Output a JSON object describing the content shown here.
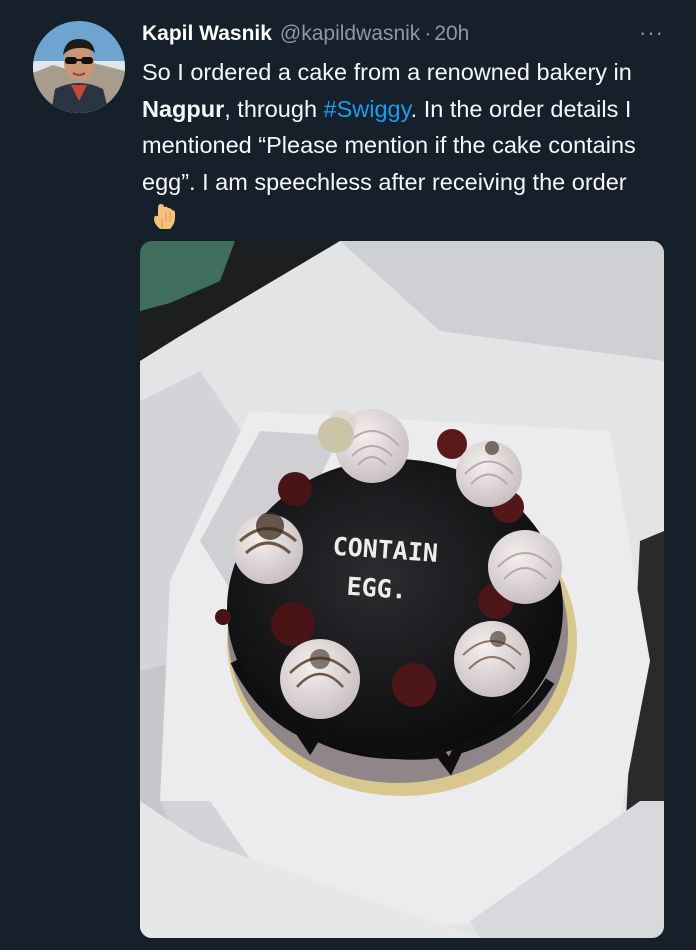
{
  "tweet": {
    "author_name": "Kapil Wasnik",
    "handle": "@kapildwasnik",
    "separator": "·",
    "time": "20h",
    "more_label": "···",
    "text_part1": "So I ordered a cake from a renowned bakery in ",
    "bold_city": "Nagpur",
    "text_part2": ", through ",
    "hashtag": "#Swiggy",
    "text_part3": ". In the order details I mentioned “Please mention if the cake contains egg”. I am speechless after receiving the order",
    "emoji": "backhand-index-pointing-down-icon"
  },
  "media": {
    "cake_text_line1": "CONTAIN",
    "cake_text_line2": "EGG."
  }
}
